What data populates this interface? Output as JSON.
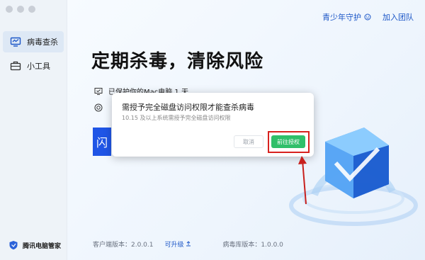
{
  "sidebar": {
    "items": [
      {
        "label": "病毒查杀",
        "icon": "monitor-icon"
      },
      {
        "label": "小工具",
        "icon": "toolbox-icon"
      }
    ],
    "brand": "腾讯电脑管家"
  },
  "topbar": {
    "teen_mode": "青少年守护",
    "join_team": "加入团队"
  },
  "main": {
    "headline": "定期杀毒，清除风险",
    "protected_text": "已保护你的Mac电脑 1 天",
    "scan_button_char": "闪"
  },
  "footer": {
    "client_version": "客户端版本：2.0.0.1",
    "upgrade": "可升级",
    "db_version": "病毒库版本：1.0.0.0"
  },
  "modal": {
    "title": "需授予完全磁盘访问权限才能查杀病毒",
    "subtitle": "10.15 及以上系统需授予完全磁盘访问权限",
    "cancel": "取消",
    "grant": "前往授权"
  },
  "colors": {
    "accent_blue": "#1b56c7",
    "scan_blue": "#1f55e6",
    "grant_green": "#2fbf6a",
    "highlight_red": "#d8221f"
  }
}
